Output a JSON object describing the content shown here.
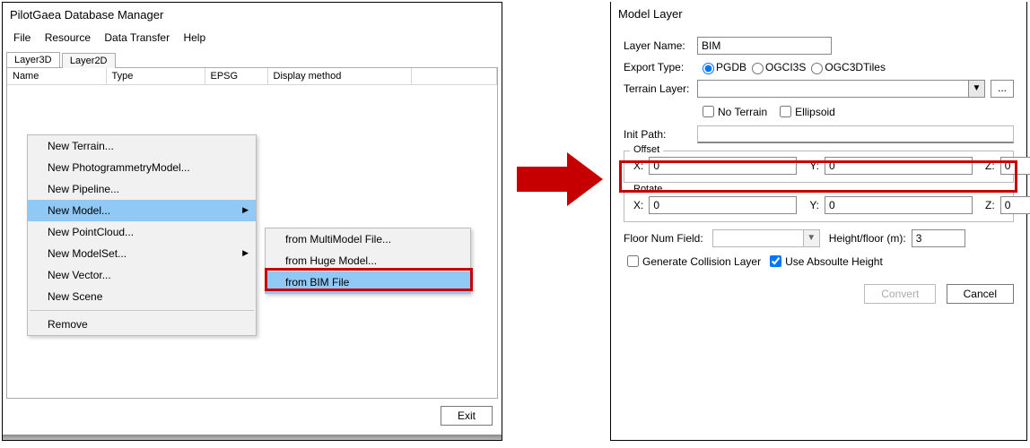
{
  "left": {
    "title": "PilotGaea Database Manager",
    "menu": {
      "file": "File",
      "resource": "Resource",
      "transfer": "Data Transfer",
      "help": "Help"
    },
    "tabs": {
      "l3d": "Layer3D",
      "l2d": "Layer2D"
    },
    "cols": {
      "name": "Name",
      "type": "Type",
      "epsg": "EPSG",
      "disp": "Display method"
    },
    "exit": "Exit"
  },
  "ctx": {
    "terrain": "New Terrain...",
    "photogram": "New PhotogrammetryModel...",
    "pipeline": "New Pipeline...",
    "model": "New Model...",
    "pointcloud": "New PointCloud...",
    "modelset": "New ModelSet...",
    "vector": "New Vector...",
    "scene": "New Scene",
    "remove": "Remove"
  },
  "sub": {
    "multi": "from MultiModel File...",
    "huge": "from Huge Model...",
    "bim": "from BIM File"
  },
  "right": {
    "title": "Model Layer",
    "layerName": {
      "label": "Layer Name:",
      "value": "BIM"
    },
    "exportType": {
      "label": "Export Type:",
      "opt1": "PGDB",
      "opt2": "OGCI3S",
      "opt3": "OGC3DTiles",
      "selected": "PGDB"
    },
    "terrainLayer": {
      "label": "Terrain Layer:",
      "noTerrain": "No Terrain",
      "ellipsoid": "Ellipsoid",
      "browse": "..."
    },
    "initPath": {
      "label": "Init Path:"
    },
    "offset": {
      "legend": "Offset",
      "x": "X:",
      "y": "Y:",
      "z": "Z:",
      "xv": "0",
      "yv": "0",
      "zv": "0"
    },
    "rotate": {
      "legend": "Rotate",
      "x": "X:",
      "y": "Y:",
      "z": "Z:",
      "xv": "0",
      "yv": "0",
      "zv": "0"
    },
    "floor": {
      "label": "Floor Num Field:",
      "heightLabel": "Height/floor (m):",
      "heightVal": "3"
    },
    "genColl": "Generate Collision Layer",
    "useAbs": "Use Absoulte Height",
    "convert": "Convert",
    "cancel": "Cancel"
  }
}
